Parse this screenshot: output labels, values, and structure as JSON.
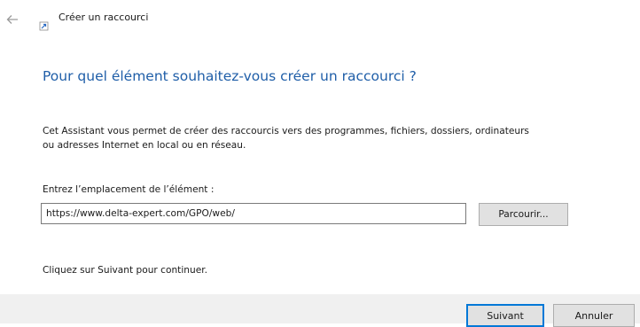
{
  "window": {
    "title": "Créer un raccourci",
    "back_icon": "back-arrow-icon",
    "app_icon": "shortcut-icon"
  },
  "main": {
    "heading": "Pour quel élément souhaitez-vous créer un raccourci ?",
    "description_line1": "Cet Assistant vous permet de créer des raccourcis vers des programmes, fichiers, dossiers, ordinateurs",
    "description_line2": "ou adresses Internet en local ou en réseau.",
    "location_label": "Entrez l’emplacement de l’élément :",
    "location_value": "https://www.delta-expert.com/GPO/web/",
    "browse_label": "Parcourir...",
    "continue_hint": "Cliquez sur Suivant pour continuer."
  },
  "footer": {
    "next_label": "Suivant",
    "cancel_label": "Annuler"
  },
  "colors": {
    "heading": "#1f5ea8",
    "accent_focus": "#0078d7",
    "footer_bg": "#f0f0f0",
    "button_bg": "#e1e1e1"
  }
}
